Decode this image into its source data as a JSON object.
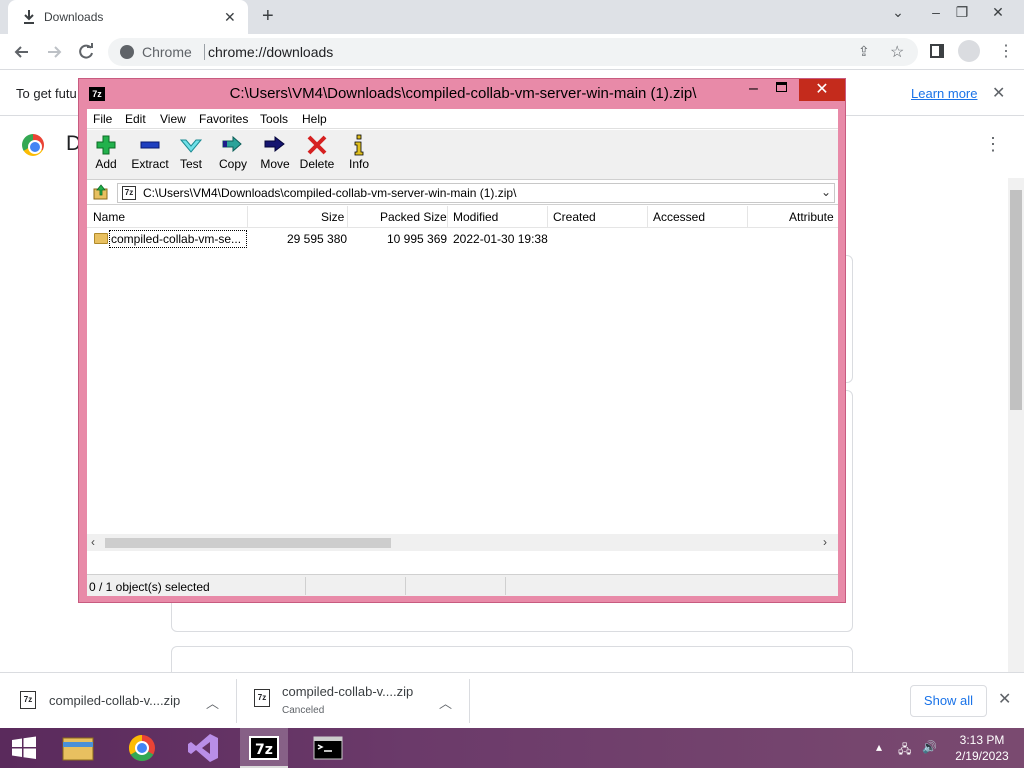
{
  "browser": {
    "tab_title": "Downloads",
    "omnibox": {
      "chip_label": "Chrome",
      "url": "chrome://downloads"
    },
    "infobar": {
      "text": "To get futu",
      "link": "Learn more"
    },
    "page": {
      "title_letter": "D"
    }
  },
  "zip_window": {
    "title": "C:\\Users\\VM4\\Downloads\\compiled-collab-vm-server-win-main (1).zip\\",
    "app_icon": "7z",
    "menu": [
      "File",
      "Edit",
      "View",
      "Favorites",
      "Tools",
      "Help"
    ],
    "toolbar": [
      {
        "label": "Add",
        "icon": "plus-icon"
      },
      {
        "label": "Extract",
        "icon": "minus-icon"
      },
      {
        "label": "Test",
        "icon": "check-icon"
      },
      {
        "label": "Copy",
        "icon": "copy-arrows-icon"
      },
      {
        "label": "Move",
        "icon": "move-arrow-icon"
      },
      {
        "label": "Delete",
        "icon": "x-icon"
      },
      {
        "label": "Info",
        "icon": "info-icon"
      }
    ],
    "address": "C:\\Users\\VM4\\Downloads\\compiled-collab-vm-server-win-main (1).zip\\",
    "columns": [
      "Name",
      "Size",
      "Packed Size",
      "Modified",
      "Created",
      "Accessed",
      "Attribute"
    ],
    "rows": [
      {
        "name": "compiled-collab-vm-se...",
        "size": "29 595 380",
        "packed": "10 995 369",
        "modified": "2022-01-30 19:38",
        "created": "",
        "accessed": "",
        "attr": ""
      }
    ],
    "status": "0 / 1 object(s) selected"
  },
  "shelf": {
    "items": [
      {
        "name": "compiled-collab-v....zip",
        "sub": ""
      },
      {
        "name": "compiled-collab-v....zip",
        "sub": "Canceled"
      }
    ],
    "show_all": "Show all"
  },
  "taskbar": {
    "apps": [
      "start-icon",
      "file-explorer-icon",
      "chrome-icon",
      "visual-studio-icon",
      "7zip-icon",
      "terminal-icon"
    ],
    "time": "3:13 PM",
    "date": "2/19/2023"
  },
  "colors": {
    "zip_frame": "#e88aa8",
    "close_red": "#c42b1c",
    "link_blue": "#1a73e8",
    "taskbar": "#6b3a6a"
  }
}
